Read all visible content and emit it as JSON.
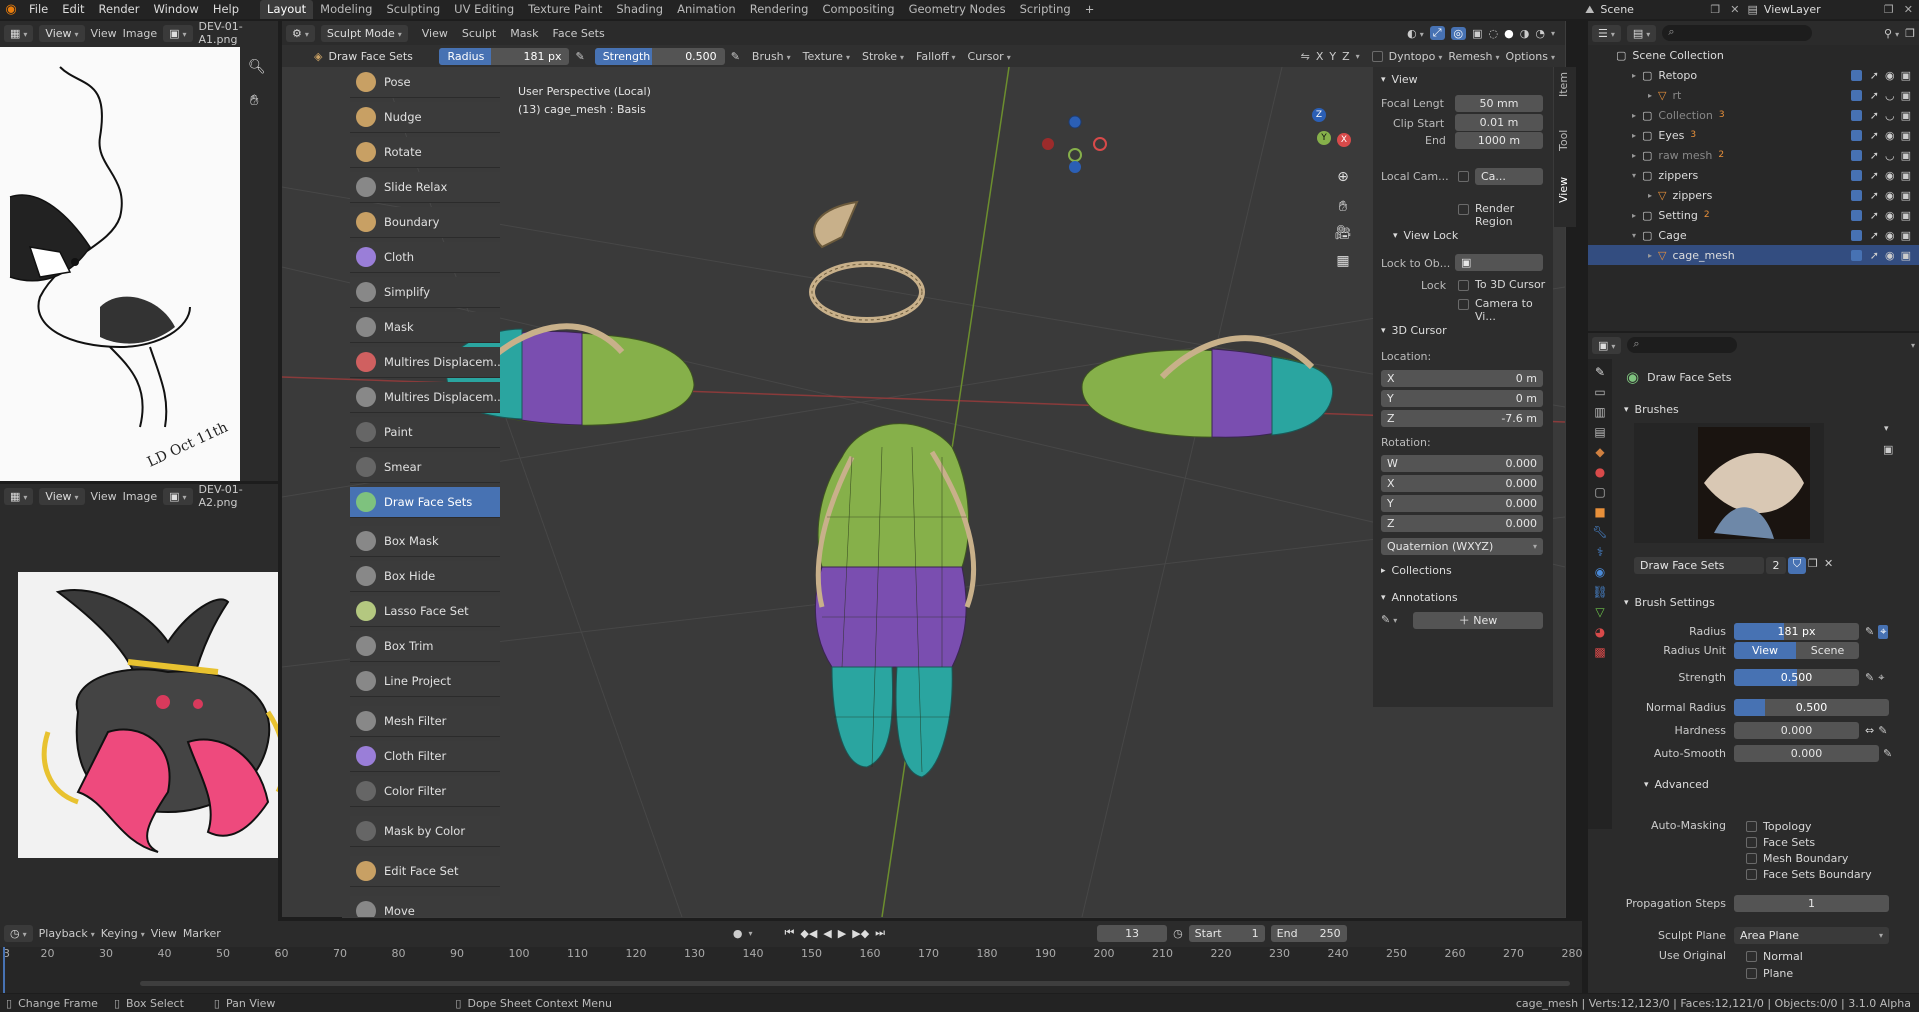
{
  "topbar": {
    "menus": [
      "File",
      "Edit",
      "Render",
      "Window",
      "Help"
    ],
    "workspaces": [
      "Layout",
      "Modeling",
      "Sculpting",
      "UV Editing",
      "Texture Paint",
      "Shading",
      "Animation",
      "Rendering",
      "Compositing",
      "Geometry Nodes",
      "Scripting"
    ],
    "active_workspace": "Layout",
    "scene": "Scene",
    "view_layer": "ViewLayer"
  },
  "image_editor_top": {
    "view": "View",
    "view2": "View",
    "image": "Image",
    "filename": "DEV-01-A1.png"
  },
  "image_editor_bottom": {
    "view": "View",
    "view2": "View",
    "image": "Image",
    "filename": "DEV-01-A2.png"
  },
  "viewport_header": {
    "mode": "Sculpt Mode",
    "menus": [
      "View",
      "Sculpt",
      "Mask",
      "Face Sets"
    ],
    "brush_name": "Draw Face Sets",
    "radius_label": "Radius",
    "radius_value": "181 px",
    "strength_label": "Strength",
    "strength_value": "0.500",
    "dropdowns": [
      "Brush",
      "Texture",
      "Stroke",
      "Falloff",
      "Cursor"
    ],
    "axes": [
      "X",
      "Y",
      "Z"
    ],
    "dyntopo": "Dyntopo",
    "remesh": "Remesh",
    "options": "Options"
  },
  "viewport_info": {
    "line1": "User Perspective (Local)",
    "line2": "(13) cage_mesh : Basis"
  },
  "tools": [
    {
      "label": "Pose",
      "color": "#c8a064"
    },
    {
      "label": "Nudge",
      "color": "#c8a064"
    },
    {
      "label": "Rotate",
      "color": "#c8a064"
    },
    {
      "label": "Slide Relax",
      "color": "#888"
    },
    {
      "label": "Boundary",
      "color": "#c8a064"
    },
    {
      "label": "Cloth",
      "color": "#9a7ed8"
    },
    {
      "label": "Simplify",
      "color": "#888"
    },
    {
      "label": "Mask",
      "color": "#888"
    },
    {
      "label": "Multires Displacem...",
      "color": "#d06060"
    },
    {
      "label": "Multires Displacem...",
      "color": "#888"
    },
    {
      "label": "Paint",
      "color": "#666"
    },
    {
      "label": "Smear",
      "color": "#666"
    },
    {
      "label": "Draw Face Sets",
      "color": "#7ec27e"
    },
    {
      "label": "Box Mask",
      "color": "#888"
    },
    {
      "label": "Box Hide",
      "color": "#888"
    },
    {
      "label": "Lasso Face Set",
      "color": "#b4c880"
    },
    {
      "label": "Box Trim",
      "color": "#888"
    },
    {
      "label": "Line Project",
      "color": "#888"
    },
    {
      "label": "Mesh Filter",
      "color": "#888"
    },
    {
      "label": "Cloth Filter",
      "color": "#9a7ed8"
    },
    {
      "label": "Color Filter",
      "color": "#666"
    },
    {
      "label": "Mask by Color",
      "color": "#666"
    },
    {
      "label": "Edit Face Set",
      "color": "#c8a064"
    },
    {
      "label": "Move",
      "color": "#888"
    }
  ],
  "npanel": {
    "tabs": [
      "Item",
      "Tool",
      "View"
    ],
    "view_title": "View",
    "focal_label": "Focal Lengt",
    "focal_value": "50 mm",
    "clip_start_label": "Clip Start",
    "clip_start_value": "0.01 m",
    "end_label": "End",
    "end_value": "1000 m",
    "local_cam_label": "Local Cam...",
    "local_cam_value": "Ca...",
    "render_region": "Render Region",
    "view_lock_title": "View Lock",
    "lock_to_obj_label": "Lock to Ob...",
    "lock_label": "Lock",
    "to_3d_cursor": "To 3D Cursor",
    "camera_to_view": "Camera to Vi...",
    "cursor_title": "3D Cursor",
    "location_label": "Location:",
    "loc": [
      {
        "axis": "X",
        "value": "0 m"
      },
      {
        "axis": "Y",
        "value": "0 m"
      },
      {
        "axis": "Z",
        "value": "-7.6 m"
      }
    ],
    "rotation_label": "Rotation:",
    "rot": [
      {
        "axis": "W",
        "value": "0.000"
      },
      {
        "axis": "X",
        "value": "0.000"
      },
      {
        "axis": "Y",
        "value": "0.000"
      },
      {
        "axis": "Z",
        "value": "0.000"
      }
    ],
    "rot_mode": "Quaternion (WXYZ)",
    "collections": "Collections",
    "annotations": "Annotations",
    "new_label": "New"
  },
  "outliner": {
    "root": "Scene Collection",
    "rows": [
      {
        "name": "Retopo",
        "indent": 1,
        "badge": ""
      },
      {
        "name": "rt",
        "indent": 2,
        "badge": ""
      },
      {
        "name": "Collection",
        "indent": 1,
        "badge": "3"
      },
      {
        "name": "Eyes",
        "indent": 1,
        "badge": "3"
      },
      {
        "name": "raw mesh",
        "indent": 1,
        "badge": "2"
      },
      {
        "name": "zippers",
        "indent": 1,
        "badge": ""
      },
      {
        "name": "zippers",
        "indent": 2,
        "badge": ""
      },
      {
        "name": "Setting",
        "indent": 1,
        "badge": "2"
      },
      {
        "name": "Cage",
        "indent": 1,
        "badge": ""
      },
      {
        "name": "cage_mesh",
        "indent": 2,
        "badge": ""
      }
    ]
  },
  "properties": {
    "brush_name": "Draw Face Sets",
    "brushes_title": "Brushes",
    "brush_field": "Draw Face Sets",
    "brush_users": "2",
    "settings_title": "Brush Settings",
    "radius_label": "Radius",
    "radius_value": "181 px",
    "radius_unit_label": "Radius Unit",
    "unit_view": "View",
    "unit_scene": "Scene",
    "strength_label": "Strength",
    "strength_value": "0.500",
    "normal_radius_label": "Normal Radius",
    "normal_radius_value": "0.500",
    "hardness_label": "Hardness",
    "hardness_value": "0.000",
    "autosmooth_label": "Auto-Smooth",
    "autosmooth_value": "0.000",
    "advanced_title": "Advanced",
    "automasking_label": "Auto-Masking",
    "automasking": [
      "Topology",
      "Face Sets",
      "Mesh Boundary",
      "Face Sets Boundary"
    ],
    "prop_steps_label": "Propagation Steps",
    "prop_steps_value": "1",
    "sculpt_plane_label": "Sculpt Plane",
    "sculpt_plane_value": "Area Plane",
    "use_original_label": "Use Original",
    "use_original": [
      "Normal",
      "Plane"
    ]
  },
  "timeline": {
    "menus": [
      "Playback",
      "Keying",
      "View",
      "Marker"
    ],
    "current_frame": "13",
    "start_label": "Start",
    "start_value": "1",
    "end_label": "End",
    "end_value": "250",
    "ticks": [
      "3",
      "20",
      "30",
      "40",
      "50",
      "60",
      "70",
      "80",
      "90",
      "100",
      "110",
      "120",
      "130",
      "140",
      "150",
      "160",
      "170",
      "180",
      "190",
      "200",
      "210",
      "220",
      "230",
      "240",
      "250",
      "260",
      "270",
      "280"
    ]
  },
  "statusbar": {
    "change_frame": "Change Frame",
    "box_select": "Box Select",
    "pan_view": "Pan View",
    "context_menu": "Dope Sheet Context Menu",
    "stats": "cage_mesh | Verts:12,123/0 | Faces:12,121/0 | Objects:0/0 | 3.1.0 Alpha"
  },
  "colors": {
    "accent": "#4772b3",
    "face_green": "#86b04a",
    "face_purple": "#7a4eb0",
    "face_teal": "#2aa5a0",
    "zipper": "#c8b08a"
  }
}
